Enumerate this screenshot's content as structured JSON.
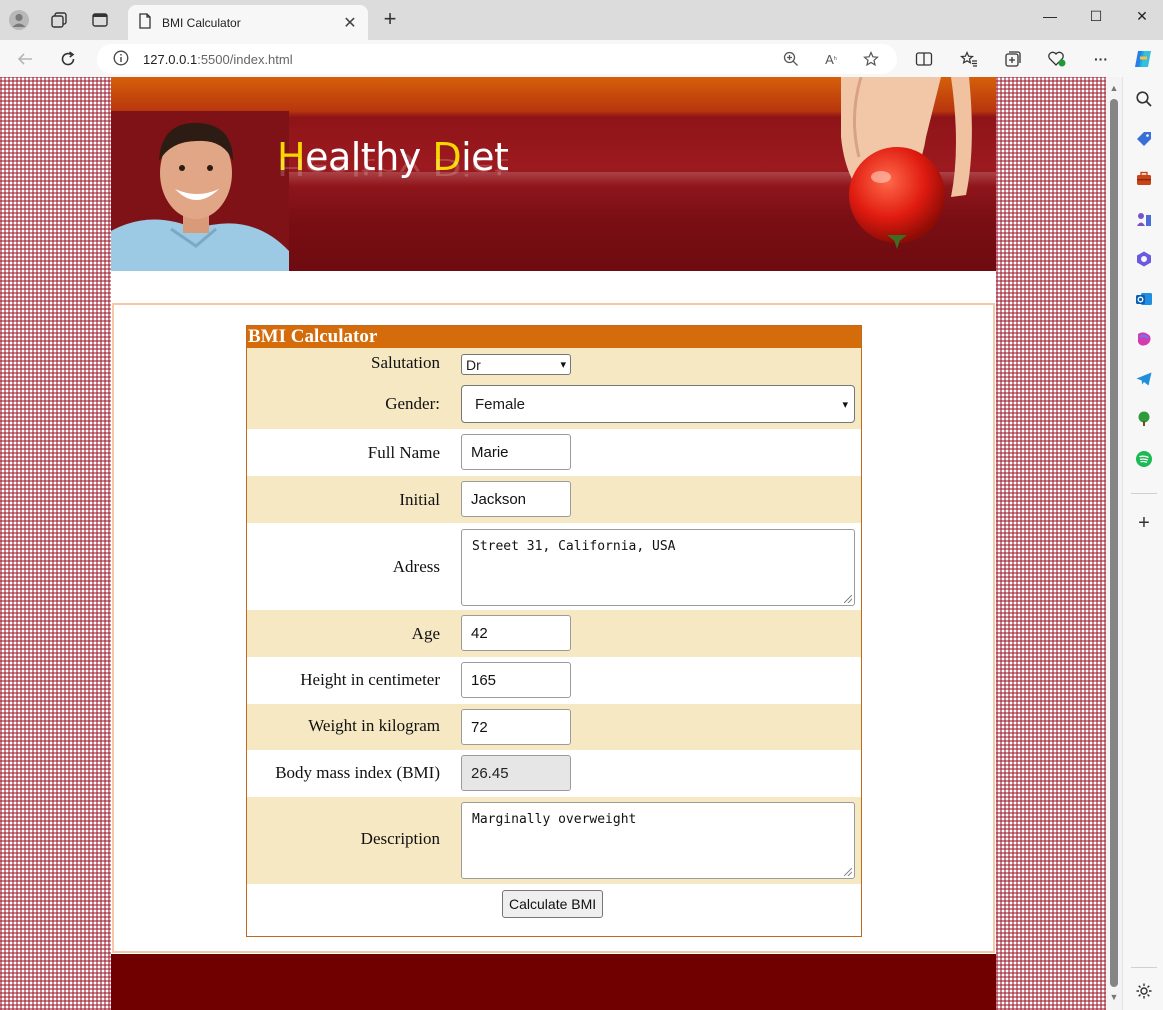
{
  "browser": {
    "tab_title": "BMI Calculator",
    "url_host": "127.0.0.1",
    "url_rest": ":5500/index.html",
    "new_tab": "+",
    "more": "···"
  },
  "header": {
    "logo_h": "H",
    "logo_ealthy": "ealthy ",
    "logo_d": "D",
    "logo_iet": "iet"
  },
  "form": {
    "title": "BMI Calculator",
    "salutation_label": "Salutation",
    "salutation_value": "Dr",
    "gender_label": "Gender:",
    "gender_value": "Female",
    "fullname_label": "Full Name",
    "fullname_value": "Marie",
    "initial_label": "Initial",
    "initial_value": "Jackson",
    "address_label": "Adress",
    "address_value": "Street 31, California, USA",
    "age_label": "Age",
    "age_value": "42",
    "height_label": "Height in centimeter",
    "height_value": "165",
    "weight_label": "Weight in kilogram",
    "weight_value": "72",
    "bmi_label": "Body mass index (BMI)",
    "bmi_value": "26.45",
    "description_label": "Description",
    "description_value": "Marginally overweight",
    "calculate_button": "Calculate BMI"
  },
  "colors": {
    "form_header": "#d56c0c",
    "row_tan": "#f5e8c2",
    "footer": "#700000"
  }
}
